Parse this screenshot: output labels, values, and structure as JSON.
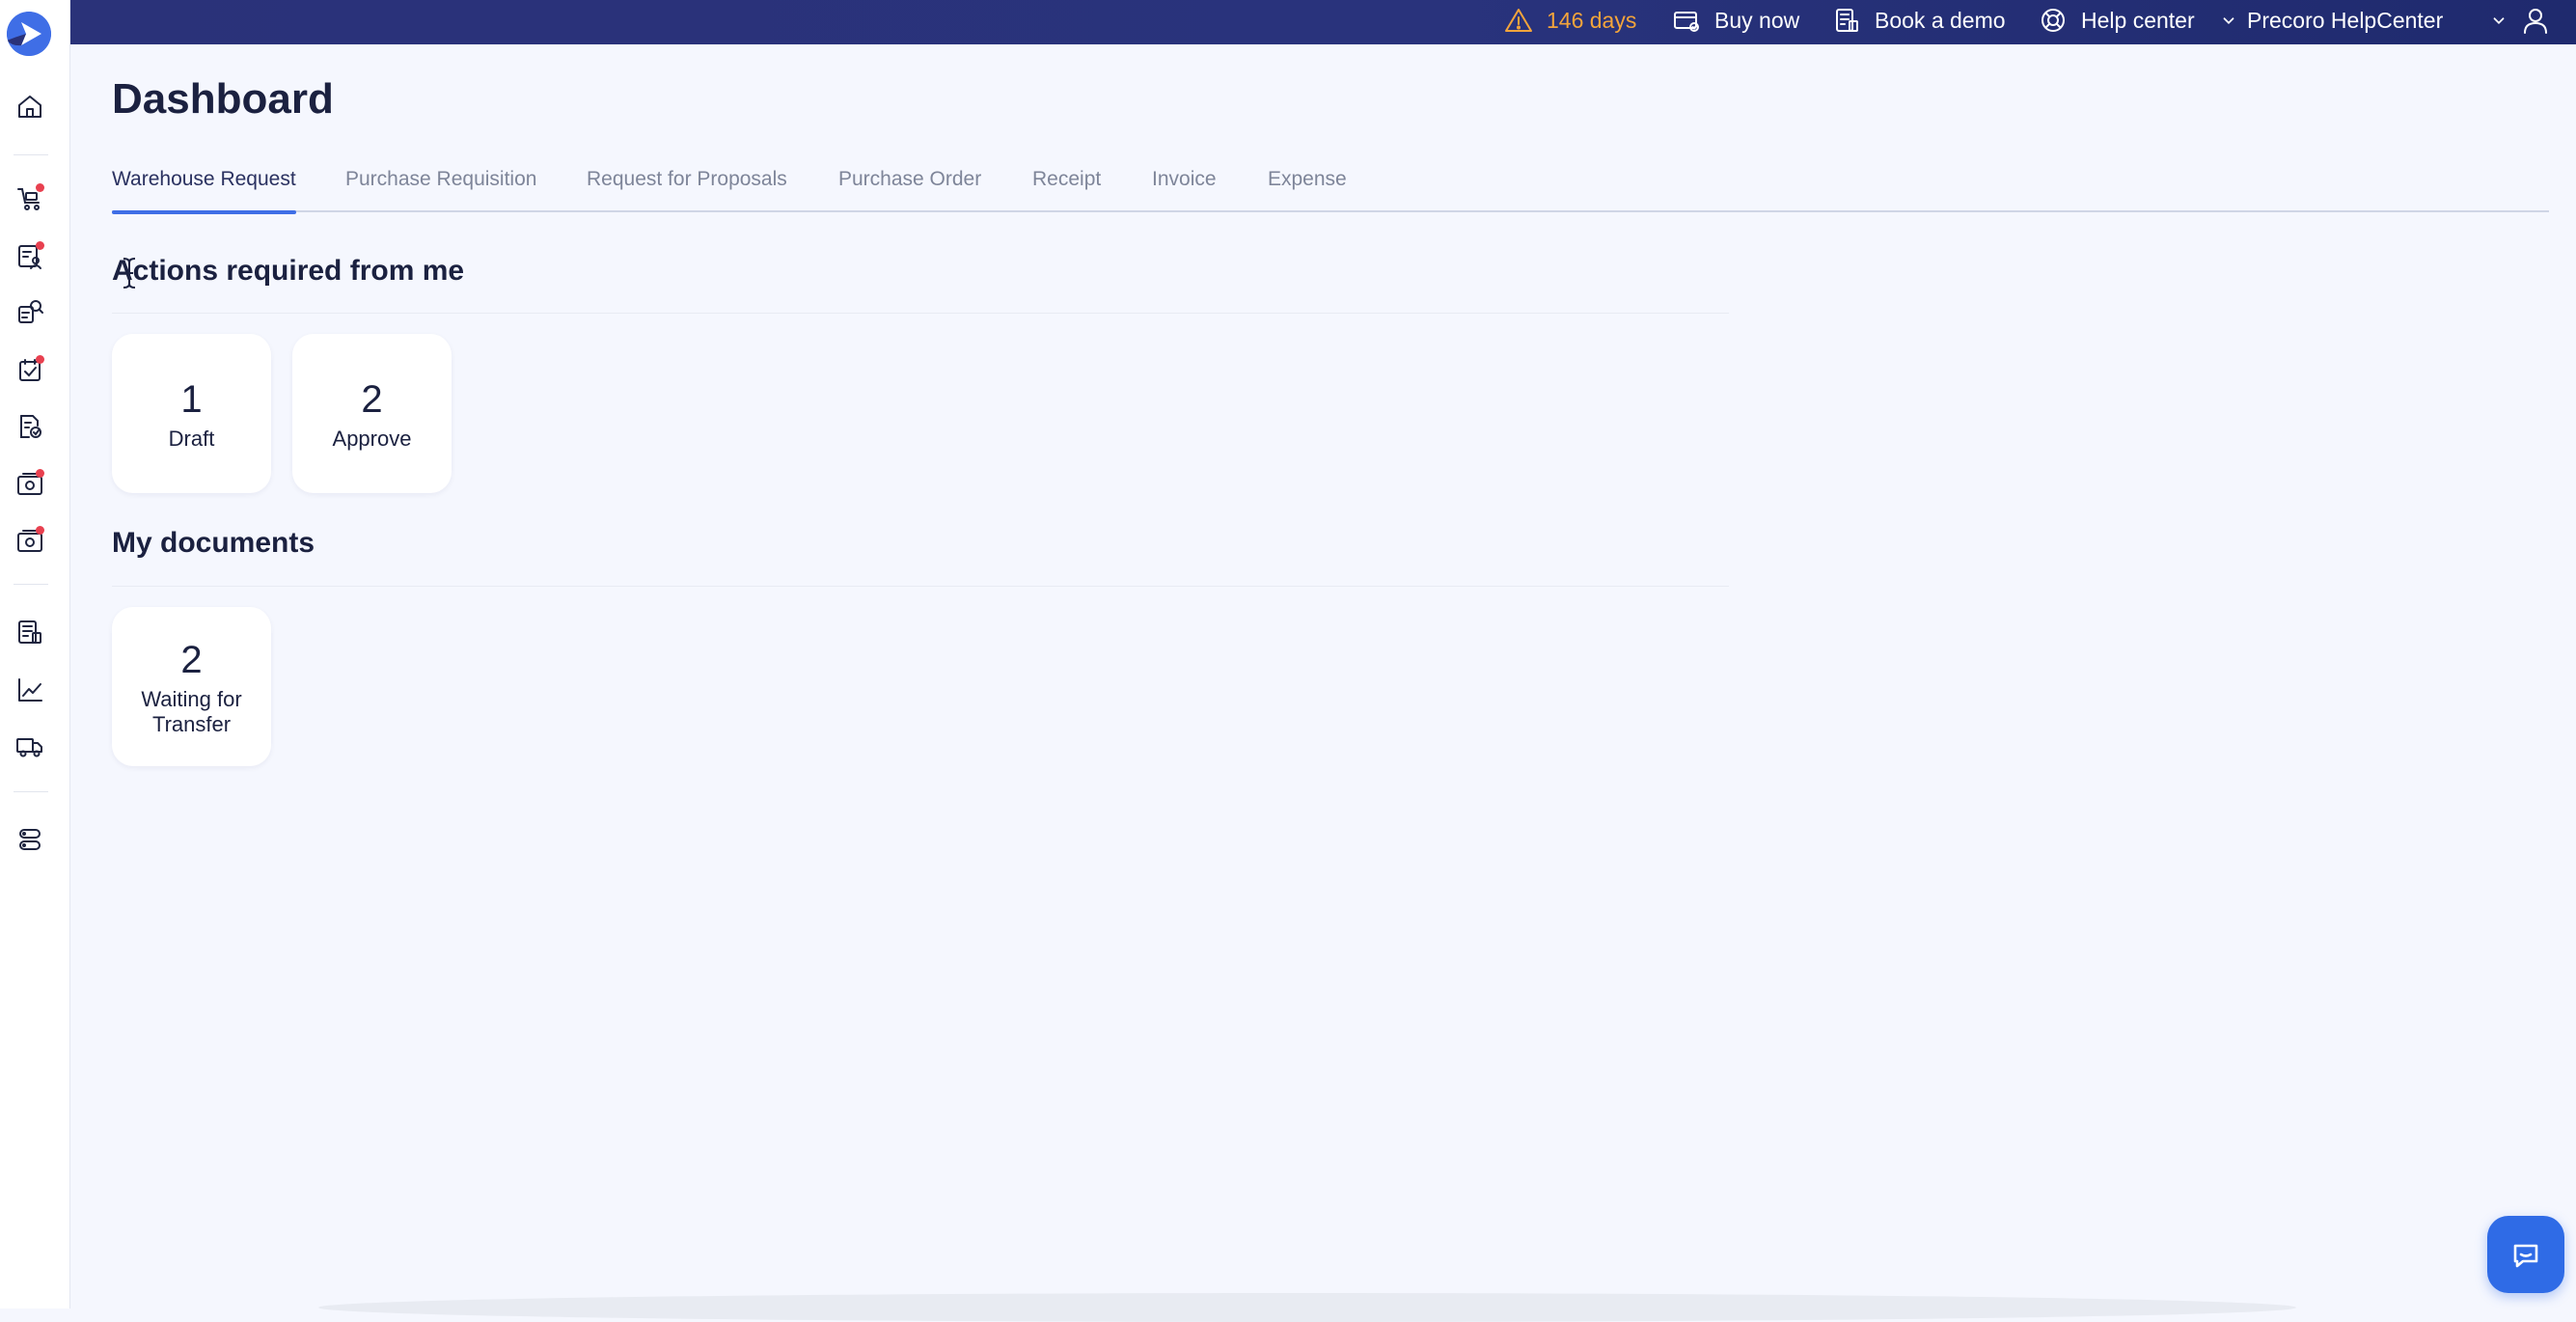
{
  "topbar": {
    "trial_text": "146 days",
    "buy_now": "Buy now",
    "book_demo": "Book a demo",
    "help_center": "Help center",
    "company": "Precoro HelpCenter"
  },
  "page": {
    "title": "Dashboard"
  },
  "tabs": [
    {
      "label": "Warehouse Request",
      "active": true
    },
    {
      "label": "Purchase Requisition",
      "active": false
    },
    {
      "label": "Request for Proposals",
      "active": false
    },
    {
      "label": "Purchase Order",
      "active": false
    },
    {
      "label": "Receipt",
      "active": false
    },
    {
      "label": "Invoice",
      "active": false
    },
    {
      "label": "Expense",
      "active": false
    }
  ],
  "sections": {
    "actions": {
      "title": "Actions required from me",
      "cards": [
        {
          "count": "1",
          "label": "Draft"
        },
        {
          "count": "2",
          "label": "Approve"
        }
      ]
    },
    "my_documents": {
      "title": "My documents",
      "cards": [
        {
          "count": "2",
          "label": "Waiting for Transfer"
        }
      ]
    }
  },
  "colors": {
    "topbar": "#29337c",
    "accent": "#3f6ee6",
    "trial": "#f3a43b",
    "badge": "#e8404f",
    "background": "#f5f7fe"
  },
  "sidebar_icons": [
    "home-icon",
    "warehouse-request-icon",
    "purchase-requisition-icon",
    "request-for-proposals-icon",
    "purchase-order-icon",
    "receipt-icon",
    "invoice-icon",
    "expense-icon",
    "budgets-icon",
    "analytics-icon",
    "suppliers-icon",
    "settings-icon"
  ]
}
